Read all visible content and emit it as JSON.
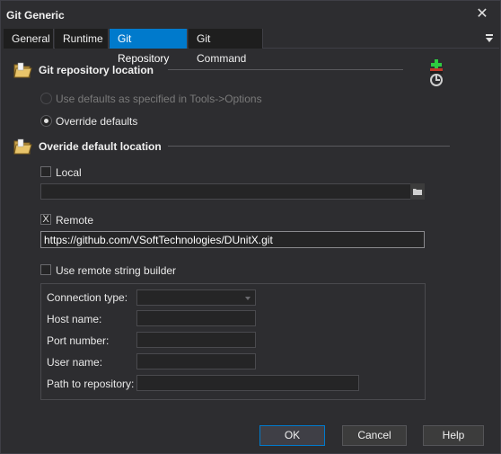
{
  "window": {
    "title": "Git Generic"
  },
  "tabs": [
    {
      "label": "General"
    },
    {
      "label": "Runtime"
    },
    {
      "label": "Git Repository",
      "active": true
    },
    {
      "label": "Git Command"
    }
  ],
  "repo_location": {
    "title": "Git repository location",
    "options": [
      {
        "label": "Use defaults as specified in Tools->Options",
        "selected": false,
        "enabled": false
      },
      {
        "label": "Override defaults",
        "selected": true,
        "enabled": true
      }
    ]
  },
  "override_location": {
    "title": "Overide default location",
    "local": {
      "label": "Local",
      "checked": false,
      "path": ""
    },
    "remote": {
      "label": "Remote",
      "checked": true,
      "check_glyph": "X",
      "url": "https://github.com/VSoftTechnologies/DUnitX.git"
    },
    "builder": {
      "label": "Use remote string builder",
      "checked": false,
      "fields": [
        {
          "label": "Connection type:",
          "value": ""
        },
        {
          "label": "Host name:",
          "value": ""
        },
        {
          "label": "Port number:",
          "value": ""
        },
        {
          "label": "User name:",
          "value": ""
        },
        {
          "label": "Path to repository:",
          "value": ""
        }
      ]
    }
  },
  "buttons": {
    "ok": "OK",
    "cancel": "Cancel",
    "help": "Help"
  },
  "colors": {
    "accent": "#007acc",
    "background": "#2d2d30",
    "field": "#252526"
  },
  "icons": [
    "close-icon",
    "tab-menu-icon",
    "folder-section-icon",
    "git-tool-icon",
    "folder-browse-icon"
  ]
}
